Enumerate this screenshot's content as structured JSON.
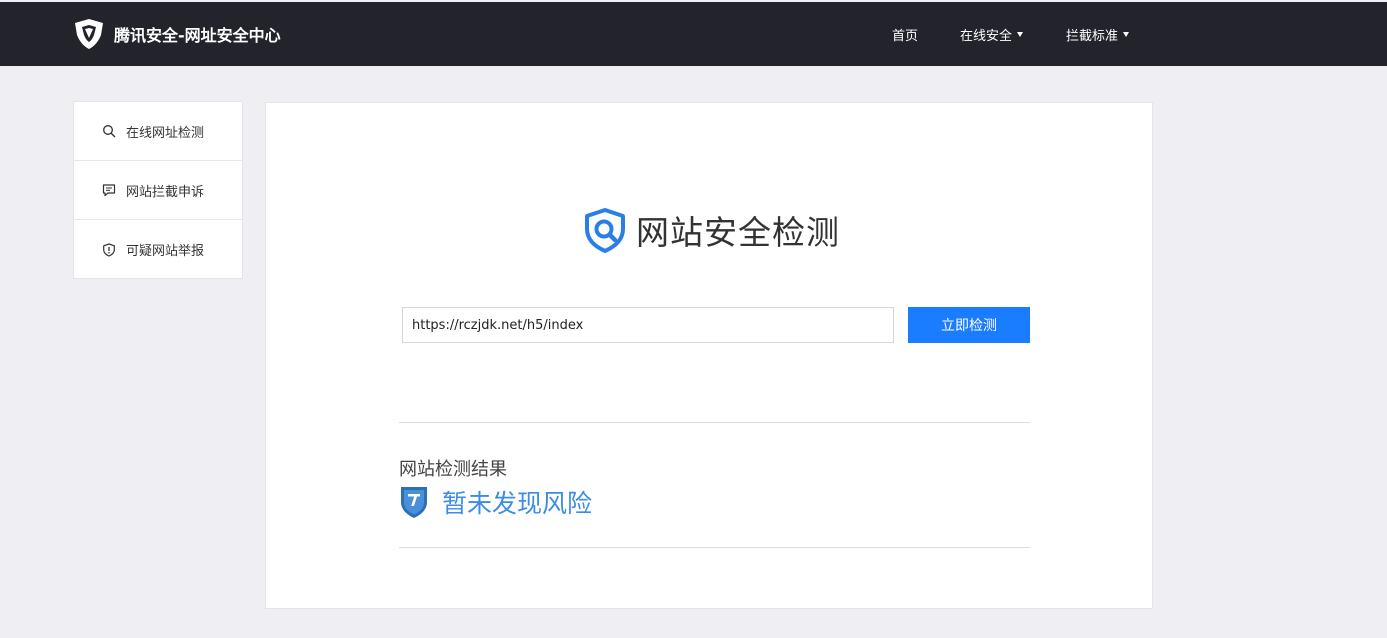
{
  "header": {
    "site_title": "腾讯安全-网址安全中心",
    "nav": {
      "home": "首页",
      "online_security": "在线安全",
      "block_standard": "拦截标准"
    }
  },
  "sidebar": {
    "items": [
      {
        "label": "在线网址检测",
        "icon": "search-icon"
      },
      {
        "label": "网站拦截申诉",
        "icon": "chat-bubble-icon"
      },
      {
        "label": "可疑网站举报",
        "icon": "shield-alert-icon"
      }
    ]
  },
  "main": {
    "title": "网站安全检测",
    "url_value": "https://rczjdk.net/h5/index",
    "check_button": "立即检测",
    "result_label": "网站检测结果",
    "result_status": "暂未发现风险"
  },
  "colors": {
    "header_bg": "#23242b",
    "accent_blue": "#1a7cff",
    "result_blue": "#3c8ce7",
    "page_bg": "#efeff3"
  }
}
